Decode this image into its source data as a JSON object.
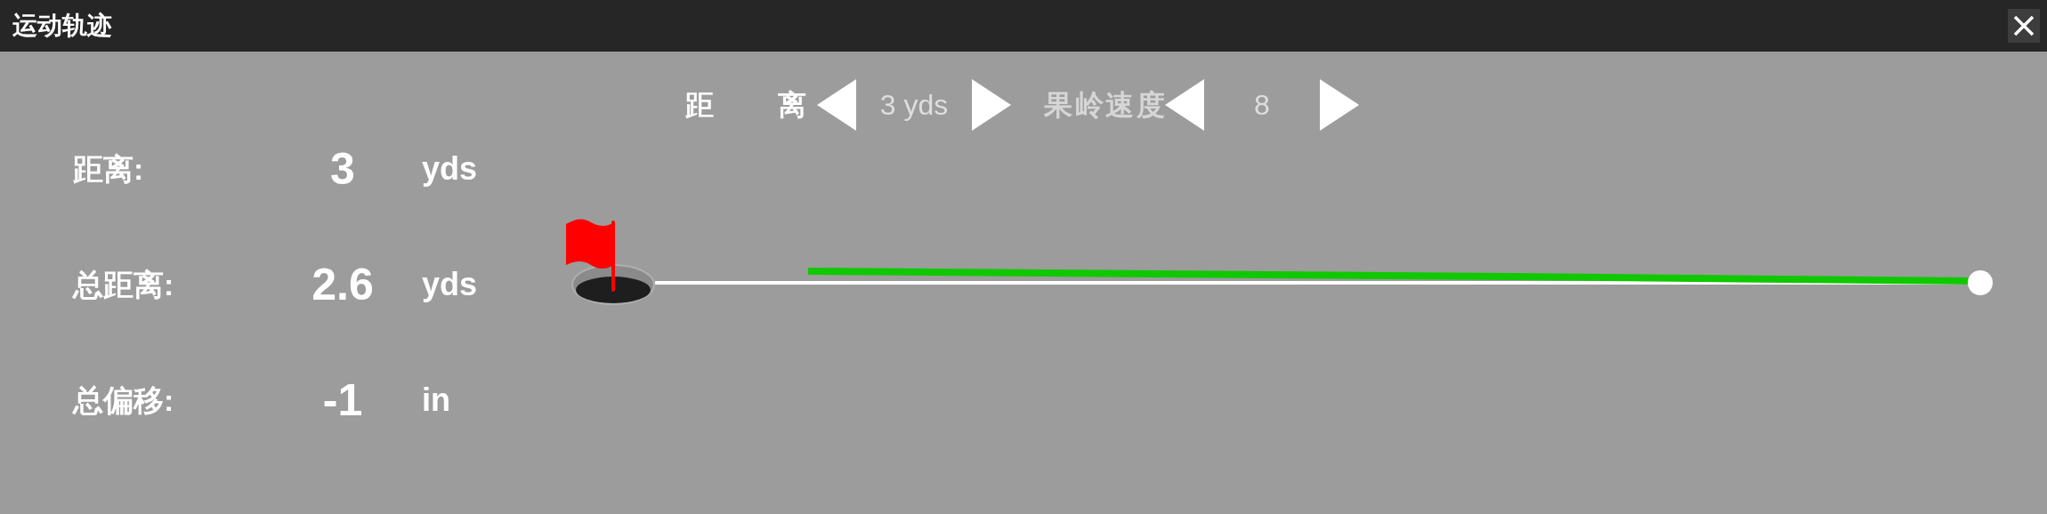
{
  "window": {
    "title": "运动轨迹"
  },
  "selectors": [
    {
      "label": "距离",
      "value": "3 yds",
      "selected": true
    },
    {
      "label": "果岭速度",
      "value": "8",
      "selected": false
    }
  ],
  "stats": [
    {
      "label": "距离:",
      "value": "3",
      "unit": "yds"
    },
    {
      "label": "总距离:",
      "value": "2.6",
      "unit": "yds"
    },
    {
      "label": "总偏移:",
      "value": "-1",
      "unit": "in"
    }
  ]
}
